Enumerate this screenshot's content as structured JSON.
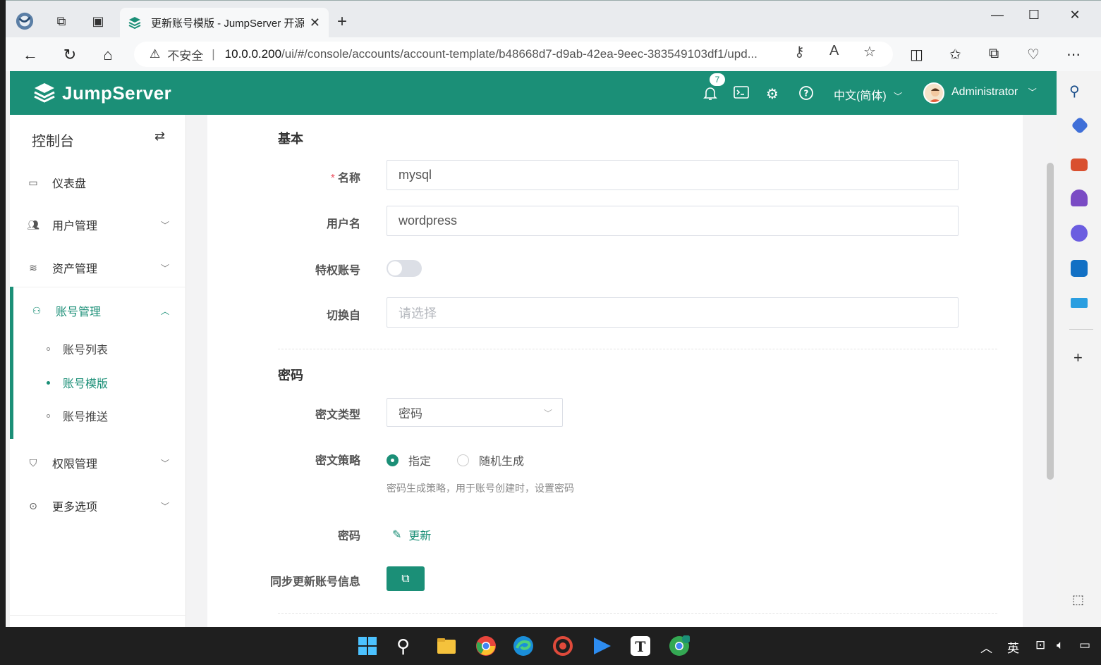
{
  "browser": {
    "tab_title": "更新账号模版 - JumpServer 开源",
    "url_warning": "不安全",
    "url_host": "10.0.0.200",
    "url_path": "/ui/#/console/accounts/account-template/b48668d7-d9ab-42ea-9eec-383549103df1/upd..."
  },
  "header": {
    "logo_text": "JumpServer",
    "notification_count": "7",
    "language": "中文(简体)",
    "username": "Administrator"
  },
  "sidebar": {
    "title": "控制台",
    "items": [
      {
        "label": "仪表盘"
      },
      {
        "label": "用户管理"
      },
      {
        "label": "资产管理"
      },
      {
        "label": "账号管理"
      },
      {
        "label": "权限管理"
      },
      {
        "label": "更多选项"
      }
    ],
    "sub_items": [
      {
        "label": "账号列表"
      },
      {
        "label": "账号模版"
      },
      {
        "label": "账号推送"
      }
    ]
  },
  "form": {
    "section_basic": "基本",
    "name_label": "名称",
    "name_value": "mysql",
    "username_label": "用户名",
    "username_value": "wordpress",
    "privileged_label": "特权账号",
    "privileged_on": false,
    "switch_from_label": "切换自",
    "switch_from_placeholder": "请选择",
    "section_secret": "密码",
    "secret_type_label": "密文类型",
    "secret_type_value": "密码",
    "secret_strategy_label": "密文策略",
    "strategy_option_specified": "指定",
    "strategy_option_random": "随机生成",
    "strategy_help": "密码生成策略，用于账号创建时，设置密码",
    "password_label": "密码",
    "password_update_link": "更新",
    "sync_label": "同步更新账号信息"
  },
  "taskbar": {
    "ime": "英"
  },
  "colors": {
    "brand": "#1b8f77"
  }
}
